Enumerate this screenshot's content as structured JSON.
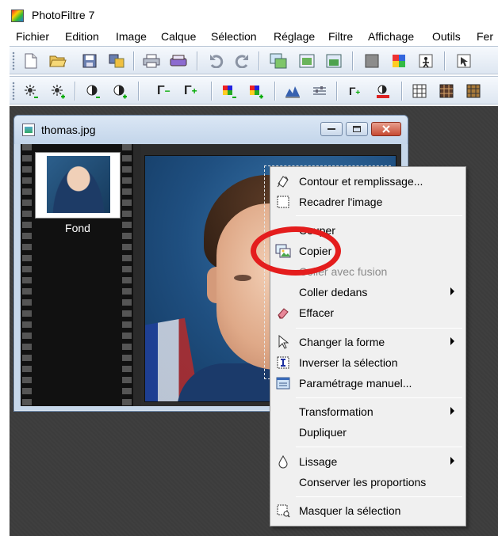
{
  "app": {
    "title": "PhotoFiltre 7"
  },
  "menu": [
    "Fichier",
    "Edition",
    "Image",
    "Calque",
    "Sélection",
    "Réglage",
    "Filtre",
    "Affichage",
    "Outils",
    "Fer"
  ],
  "toolbar1": [
    "new-icon",
    "open-icon",
    "save-icon",
    "save-as-icon",
    "print-icon",
    "scan-icon",
    "undo-icon",
    "redo-icon",
    "copy-image-icon",
    "paste-image-icon",
    "paste-layer-icon",
    "fill-icon",
    "palette-icon",
    "magic-icon",
    "selection-tool-icon"
  ],
  "toolbar2": [
    "brightness-minus-icon",
    "brightness-plus-icon",
    "contrast-minus-icon",
    "contrast-plus-icon",
    "gamma-minus-icon",
    "gamma-plus-icon",
    "saturation-minus-icon",
    "saturation-plus-icon",
    "levels-icon",
    "balance-icon",
    "gamma-auto-icon",
    "contrast-auto-icon",
    "grid-icon",
    "grid-dark-icon",
    "grid-more-icon"
  ],
  "document": {
    "title": "thomas.jpg",
    "layer_label": "Fond"
  },
  "context_menu": {
    "items": [
      {
        "label": "Contour et remplissage...",
        "icon": "fill-outline-icon",
        "enabled": true
      },
      {
        "label": "Recadrer l'image",
        "icon": "crop-icon",
        "enabled": true
      },
      {
        "label": "Couper",
        "icon": "cut-icon",
        "enabled": true
      },
      {
        "label": "Copier",
        "icon": "copy-icon",
        "enabled": true
      },
      {
        "label": "Coller avec fusion",
        "icon": "",
        "enabled": false
      },
      {
        "label": "Coller dedans",
        "icon": "",
        "enabled": true,
        "submenu": true
      },
      {
        "label": "Effacer",
        "icon": "eraser-icon",
        "enabled": true
      },
      {
        "label": "Changer la forme",
        "icon": "pointer-icon",
        "enabled": true,
        "submenu": true
      },
      {
        "label": "Inverser la sélection",
        "icon": "invert-selection-icon",
        "enabled": true
      },
      {
        "label": "Paramétrage manuel...",
        "icon": "manual-settings-icon",
        "enabled": true
      },
      {
        "label": "Transformation",
        "icon": "",
        "enabled": true,
        "submenu": true
      },
      {
        "label": "Dupliquer",
        "icon": "",
        "enabled": true
      },
      {
        "label": "Lissage",
        "icon": "droplet-icon",
        "enabled": true,
        "submenu": true
      },
      {
        "label": "Conserver les proportions",
        "icon": "",
        "enabled": true
      },
      {
        "label": "Masquer la sélection",
        "icon": "hide-selection-icon",
        "enabled": true
      }
    ]
  },
  "annotation": {
    "highlight_color": "#e41d1d",
    "highlighted_item": "Copier"
  }
}
